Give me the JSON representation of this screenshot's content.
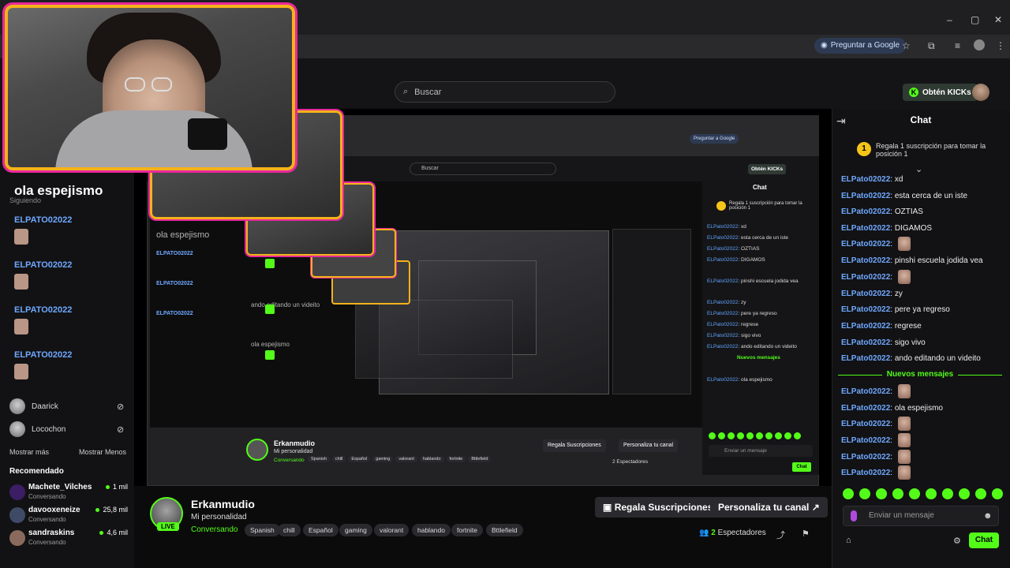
{
  "browser": {
    "google_button": "Preguntar a Google",
    "window_controls": [
      "–",
      "▢",
      "✕"
    ]
  },
  "header": {
    "search_placeholder": "Buscar",
    "kicks_label": "Obtén KICKs"
  },
  "sidebar": {
    "overlay_users": [
      "ELPATO02022",
      "ELPATO02022",
      "ELPATO02022",
      "ELPATO02022"
    ],
    "following_label": "Siguiendo",
    "big_message": "ola espejismo",
    "users": [
      {
        "name": "Daarick"
      },
      {
        "name": "Locochon"
      }
    ],
    "show_more": "Mostrar más",
    "show_less": "Mostrar Menos",
    "recommended_title": "Recomendado",
    "recommended": [
      {
        "name": "Machete_Vilches",
        "status": "Conversando",
        "viewers": "1 mil"
      },
      {
        "name": "davooxeneize",
        "status": "Conversando",
        "viewers": "25,8 mil"
      },
      {
        "name": "sandraskins",
        "status": "Conversando",
        "viewers": "4,6 mil"
      }
    ]
  },
  "video": {
    "overlay_message": "ola espejismo",
    "nested_messages": [
      "ELPATO02022",
      "ELPATO02022",
      "ELPATO02022"
    ],
    "nested_video_texts": [
      "ando editando un videito",
      "ola espejismo"
    ],
    "nested_chat": [
      {
        "user": "ELPato02022",
        "text": "xd"
      },
      {
        "user": "ELPato02022",
        "text": "esta cerca de un iste"
      },
      {
        "user": "ELPato02022",
        "text": "OZTIAS"
      },
      {
        "user": "ELPato02022",
        "text": "DIGAMOS"
      },
      {
        "user": "ELPato02022",
        "text": "pinshi escuela jodida vea"
      },
      {
        "user": "ELPato02022",
        "text": "zy"
      },
      {
        "user": "ELPato02022",
        "text": "pere ya regreso"
      },
      {
        "user": "ELPato02022",
        "text": "regrese"
      },
      {
        "user": "ELPato02022",
        "text": "sigo vivo"
      },
      {
        "user": "ELPato02022",
        "text": "ando editando un videito"
      },
      {
        "user": "ELPato02022",
        "text": "ola espejismo"
      }
    ],
    "nested_new_messages": "Nuevos mensajes",
    "nested_streamer": "Erkanmudio",
    "nested_title": "Mi personalidad",
    "nested_category": "Conversando",
    "nested_tags": [
      "Spanish",
      "chill",
      "Español",
      "gaming",
      "valorant",
      "hablando",
      "fortnite",
      "Bttlefield"
    ],
    "nested_gift": "Regala Suscripciones",
    "nested_customize": "Personaliza tu canal",
    "nested_viewers": "2 Espectadores",
    "nested_chat_title": "Chat",
    "nested_sub_text": "Regala 1 suscripción para tomar la posición 1",
    "nested_input": "Enviar un mensaje",
    "nested_chat_button": "Chat"
  },
  "stream": {
    "streamer": "Erkanmudio",
    "live_label": "LIVE",
    "title": "Mi personalidad",
    "category": "Conversando",
    "tags": [
      "Spanish",
      "chill",
      "Español",
      "gaming",
      "valorant",
      "hablando",
      "fortnite",
      "Bttlefield"
    ],
    "gift_button": "Regala Suscripciones",
    "customize_button": "Personaliza tu canal",
    "viewer_count": "2",
    "viewer_label": "Espectadores"
  },
  "chat": {
    "title": "Chat",
    "sub_badge": "1",
    "sub_text": "Regala 1 suscripción para tomar la posición 1",
    "messages": [
      {
        "user": "ELPato02022",
        "text": "xd",
        "emote": false
      },
      {
        "user": "ELPato02022",
        "text": "esta cerca de un iste",
        "emote": false
      },
      {
        "user": "ELPato02022",
        "text": "OZTIAS",
        "emote": false
      },
      {
        "user": "ELPato02022",
        "text": "DIGAMOS",
        "emote": false
      },
      {
        "user": "ELPato02022",
        "text": "",
        "emote": true
      },
      {
        "user": "ELPato02022",
        "text": "pinshi escuela jodida vea",
        "emote": false
      },
      {
        "user": "ELPato02022",
        "text": "",
        "emote": true
      },
      {
        "user": "ELPato02022",
        "text": "zy",
        "emote": false
      },
      {
        "user": "ELPato02022",
        "text": "pere ya regreso",
        "emote": false
      },
      {
        "user": "ELPato02022",
        "text": "regrese",
        "emote": false
      },
      {
        "user": "ELPato02022",
        "text": "sigo vivo",
        "emote": false
      },
      {
        "user": "ELPato02022",
        "text": "ando editando un videito",
        "emote": false
      }
    ],
    "new_messages_label": "Nuevos mensajes",
    "new_messages": [
      {
        "user": "ELPato02022",
        "text": "",
        "emote": true
      },
      {
        "user": "ELPato02022",
        "text": "ola espejismo",
        "emote": false
      },
      {
        "user": "ELPato02022",
        "text": "",
        "emote": true
      },
      {
        "user": "ELPato02022",
        "text": "",
        "emote": true
      },
      {
        "user": "ELPato02022",
        "text": "",
        "emote": true
      },
      {
        "user": "ELPato02022",
        "text": "",
        "emote": true
      }
    ],
    "input_placeholder": "Enviar un mensaje",
    "send_button": "Chat"
  },
  "colors": {
    "accent": "#53fc18",
    "username": "#6fa8ff",
    "cam_border": "#f5b21a",
    "cam_glow": "#e8289c"
  }
}
